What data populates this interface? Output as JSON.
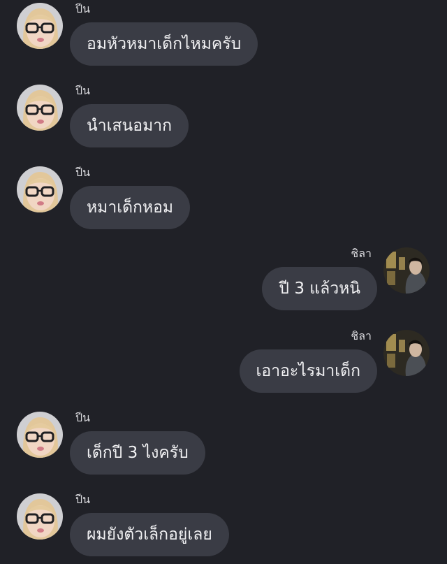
{
  "chat": {
    "messages": [
      {
        "direction": "incoming",
        "sender": "ปีน",
        "text": "อมหัวหมาเด็กไหมครับ"
      },
      {
        "direction": "incoming",
        "sender": "ปีน",
        "text": "นำเสนอมาก"
      },
      {
        "direction": "incoming",
        "sender": "ปีน",
        "text": "หมาเด็กหอม"
      },
      {
        "direction": "outgoing",
        "sender": "ชิลา",
        "text": "ปี 3 แล้วหนิ"
      },
      {
        "direction": "outgoing",
        "sender": "ชิลา",
        "text": "เอาอะไรมาเด็ก"
      },
      {
        "direction": "incoming",
        "sender": "ปีน",
        "text": "เด็กปี 3 ไงครับ"
      },
      {
        "direction": "incoming",
        "sender": "ปีน",
        "text": "ผมยังตัวเล็กอยู่เลย"
      }
    ]
  },
  "colors": {
    "background": "#202127",
    "bubble": "#3a3c45",
    "text": "#f1f1f3",
    "sender": "#d8d8dc"
  },
  "icons": {
    "incoming_avatar": "avatar-woman-glasses",
    "outgoing_avatar": "avatar-man-dark-room"
  }
}
